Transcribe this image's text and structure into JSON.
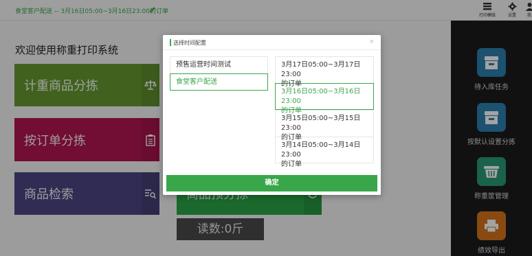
{
  "header": {
    "title": "食堂客户配送 -- 3月16日05:00~3月16日23:00的订单",
    "buttons": [
      {
        "label": "打印模版",
        "icon": "printer-template-icon"
      },
      {
        "label": "设置",
        "icon": "gear-icon"
      },
      {
        "label": "我",
        "icon": "user-icon"
      }
    ]
  },
  "main": {
    "welcome": "欢迎使用称重打印系统",
    "tiles": [
      {
        "label": "计重商品分拣",
        "color": "#679a31",
        "icon": "scale-icon"
      },
      {
        "label": "按订单分拣",
        "color": "#b31551",
        "icon": "clipboard-icon"
      },
      {
        "label": "商品检索",
        "color": "#4c4582",
        "icon": "list-search-icon"
      },
      {
        "label": "商品预分拣",
        "color": "#2aa447",
        "icon": "refresh-icon"
      }
    ],
    "readout": "读数:0斤"
  },
  "right_panel": [
    {
      "label": "待入库任务",
      "color": "#2d7fb0",
      "icon": "inbox-icon"
    },
    {
      "label": "按默认设置分拣",
      "color": "#2d7fb0",
      "icon": "inbox-icon"
    },
    {
      "label": "称重筐管理",
      "color": "#2a9a78",
      "icon": "basket-icon"
    },
    {
      "label": "绩效导出",
      "color": "#d7751c",
      "icon": "printer-icon"
    }
  ],
  "modal": {
    "title": "选择时间配置",
    "close": "×",
    "configs": [
      "预售运营时间测试",
      "食堂客户配送"
    ],
    "selected_config": 1,
    "ranges": [
      {
        "line1": "3月17日05:00~3月17日23:00",
        "line2": "的订单"
      },
      {
        "line1": "3月16日05:00~3月16日23:00",
        "line2": "的订单"
      },
      {
        "line1": "3月15日05:00~3月15日23:00",
        "line2": "的订单"
      },
      {
        "line1": "3月14日05:00~3月14日23:00",
        "line2": "的订单"
      }
    ],
    "selected_range": 1,
    "confirm_label": "确定"
  },
  "colors": {
    "accent": "#3aa64a"
  }
}
